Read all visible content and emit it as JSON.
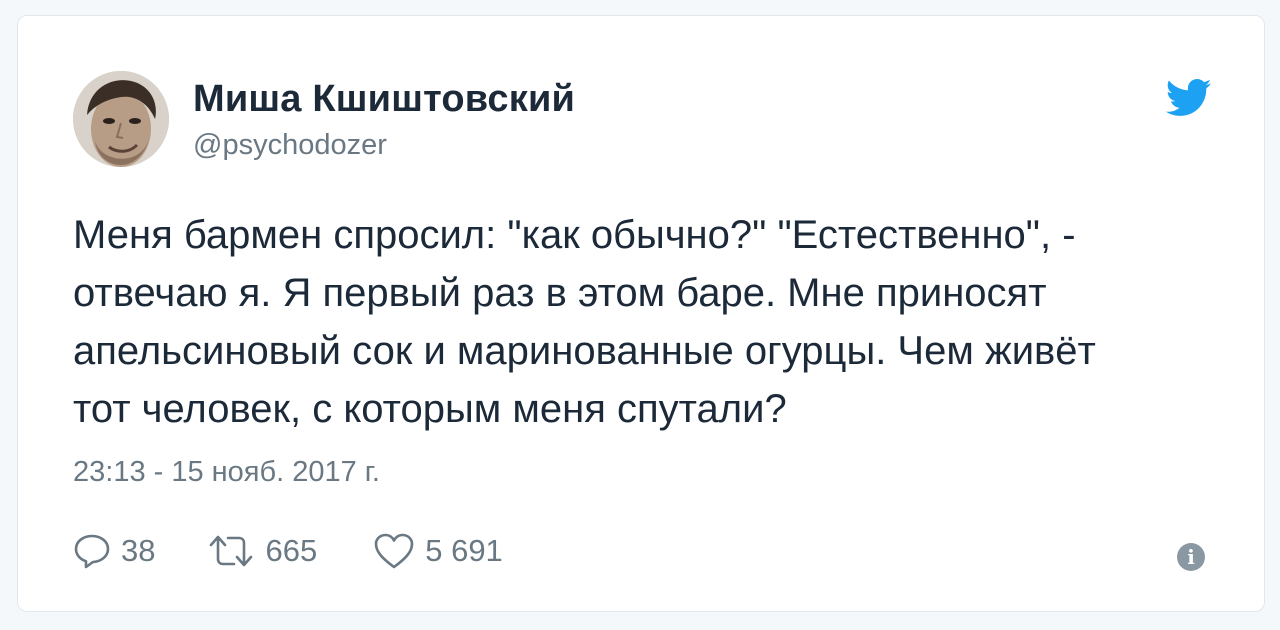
{
  "tweet": {
    "author": {
      "name": "Миша Кшиштовский",
      "handle": "@psychodozer",
      "avatar_icon": "user-avatar-photo"
    },
    "text_lines": [
      "Меня бармен спросил: \"как обычно?\" \"Естественно\", -",
      "отвечаю я. Я первый раз в этом баре. Мне приносят",
      "апельсиновый сок и маринованные огурцы. Чем живёт",
      "тот человек, с которым меня спутали?"
    ],
    "timestamp": "23:13 - 15 нояб. 2017 г.",
    "actions": {
      "replies": "38",
      "retweets": "665",
      "likes": "5 691"
    },
    "icons": {
      "brand": "twitter-bird-icon",
      "reply": "reply-icon",
      "retweet": "retweet-icon",
      "like": "heart-icon",
      "info": "info-icon"
    },
    "info_glyph": "i"
  },
  "colors": {
    "brand_blue": "#1da1f2",
    "text": "#1c2938",
    "muted": "#697882",
    "border": "#e1e8ed",
    "background": "#f5f8fa"
  }
}
